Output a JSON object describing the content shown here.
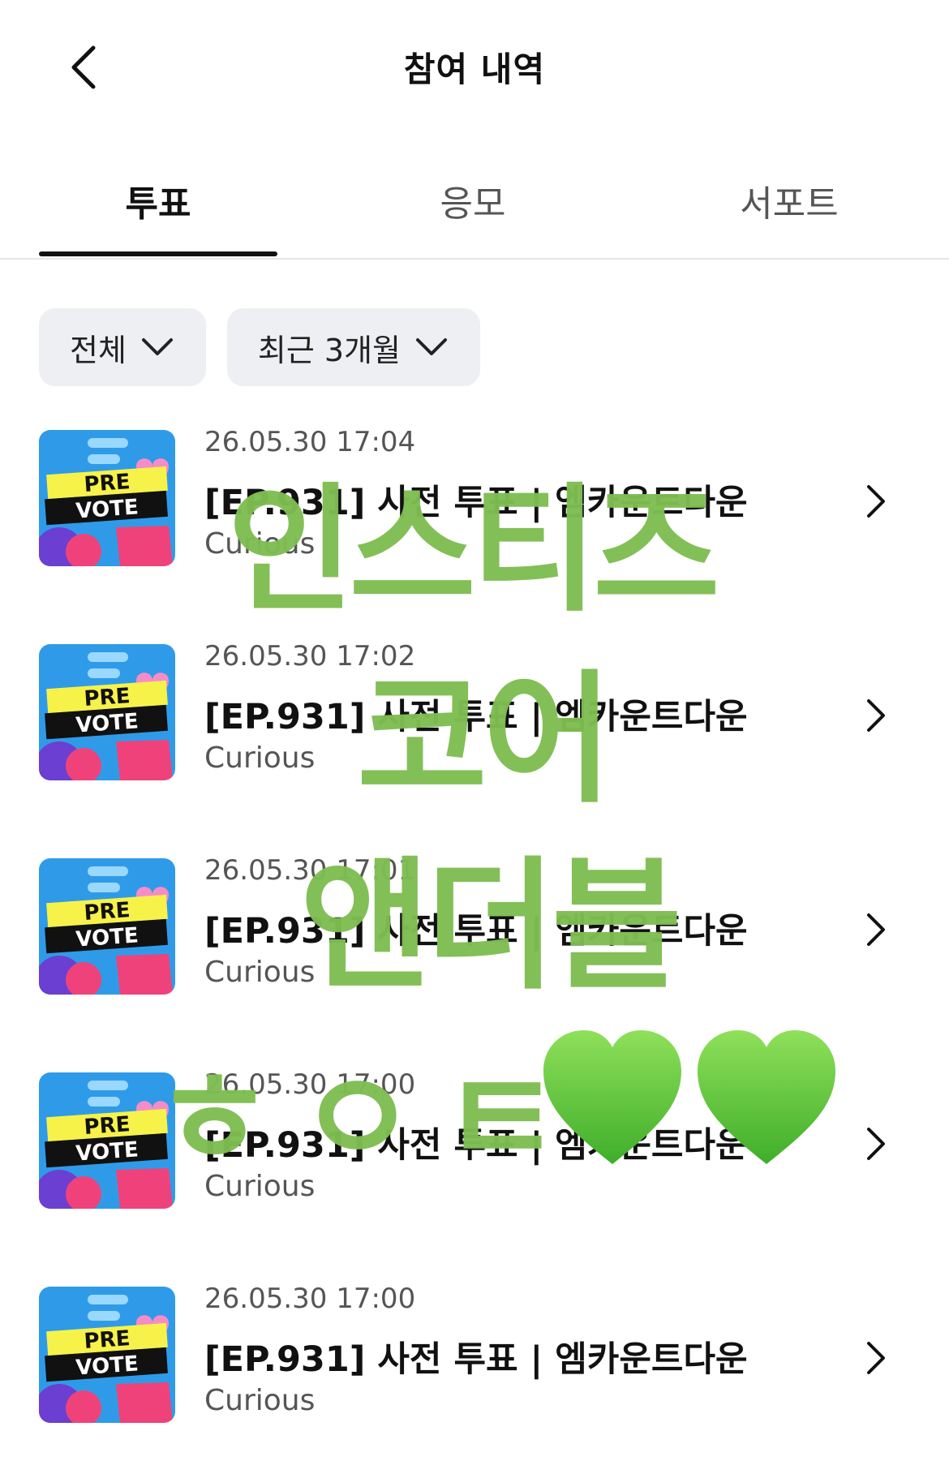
{
  "header": {
    "title": "참여 내역",
    "back_icon": "chevron-left-icon"
  },
  "tabs": [
    {
      "label": "투표",
      "active": true
    },
    {
      "label": "응모",
      "active": false
    },
    {
      "label": "서포트",
      "active": false
    }
  ],
  "filters": [
    {
      "label": "전체",
      "icon": "chevron-down-icon"
    },
    {
      "label": "최근 3개월",
      "icon": "chevron-down-icon"
    }
  ],
  "items": [
    {
      "date": "26.05.30 17:04",
      "title": "[EP.931] 사전 투표 | 엠카운트다운",
      "subtitle": "Curious",
      "thumb_line1": "PRE",
      "thumb_line2": "VOTE"
    },
    {
      "date": "26.05.30 17:02",
      "title": "[EP.931] 사전 투표 | 엠카운트다운",
      "subtitle": "Curious",
      "thumb_line1": "PRE",
      "thumb_line2": "VOTE"
    },
    {
      "date": "26.05.30 17:01",
      "title": "[EP.931] 사전 투표 | 엠카운트다운",
      "subtitle": "Curious",
      "thumb_line1": "PRE",
      "thumb_line2": "VOTE"
    },
    {
      "date": "26.05.30 17:00",
      "title": "[EP.931] 사전 투표 | 엠카운트다운",
      "subtitle": "Curious",
      "thumb_line1": "PRE",
      "thumb_line2": "VOTE"
    },
    {
      "date": "26.05.30 17:00",
      "title": "[EP.931] 사전 투표 | 엠카운트다운",
      "subtitle": "Curious",
      "thumb_line1": "PRE",
      "thumb_line2": "VOTE"
    }
  ],
  "overlay": {
    "lines": [
      "인스티즈",
      "코어",
      "앤더블",
      "ㅎㅇㅌ"
    ],
    "color": "#7fbd52",
    "heart_icon": "green-heart-icon"
  },
  "colors": {
    "accent": "#111111",
    "chip_bg": "#eeeff2",
    "thumb_bg": "#2f9be8",
    "thumb_pink": "#f0427a",
    "thumb_yellow": "#f7f24a"
  }
}
